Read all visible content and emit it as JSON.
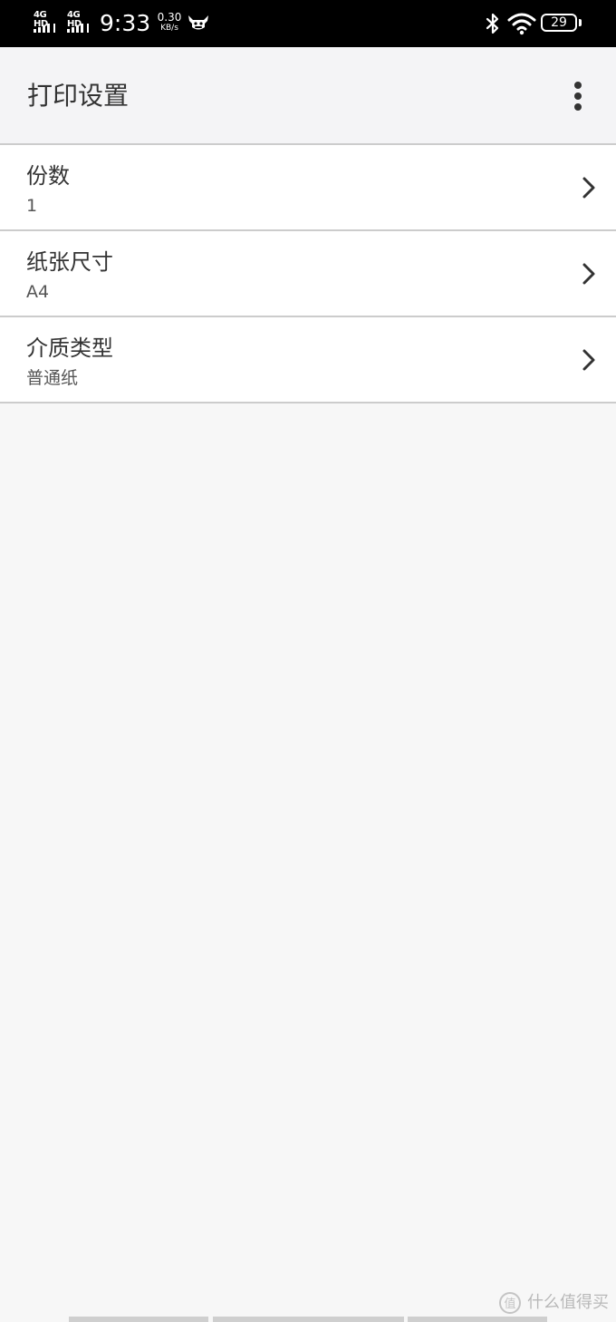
{
  "status_bar": {
    "sim1_label": "4G HD",
    "sim2_label": "4G HD",
    "time": "9:33",
    "net_speed_value": "0.30",
    "net_speed_unit": "KB/s",
    "notification_icon": "bull-mascot-icon",
    "bluetooth_icon": "bluetooth-icon",
    "wifi_icon": "wifi-icon",
    "battery_level": "29"
  },
  "app_bar": {
    "title": "打印设置",
    "menu_icon": "more-vertical-icon"
  },
  "settings": [
    {
      "title": "份数",
      "value": "1"
    },
    {
      "title": "纸张尺寸",
      "value": "A4"
    },
    {
      "title": "介质类型",
      "value": "普通纸"
    }
  ],
  "watermark": {
    "text": "什么值得买",
    "icon": "smzdm-logo-icon"
  },
  "colors": {
    "status_bar_bg": "#000000",
    "app_bar_bg": "#f4f4f6",
    "page_bg": "#f7f7f7",
    "row_bg": "#ffffff",
    "divider": "#cccccc",
    "text_primary": "#333333"
  }
}
